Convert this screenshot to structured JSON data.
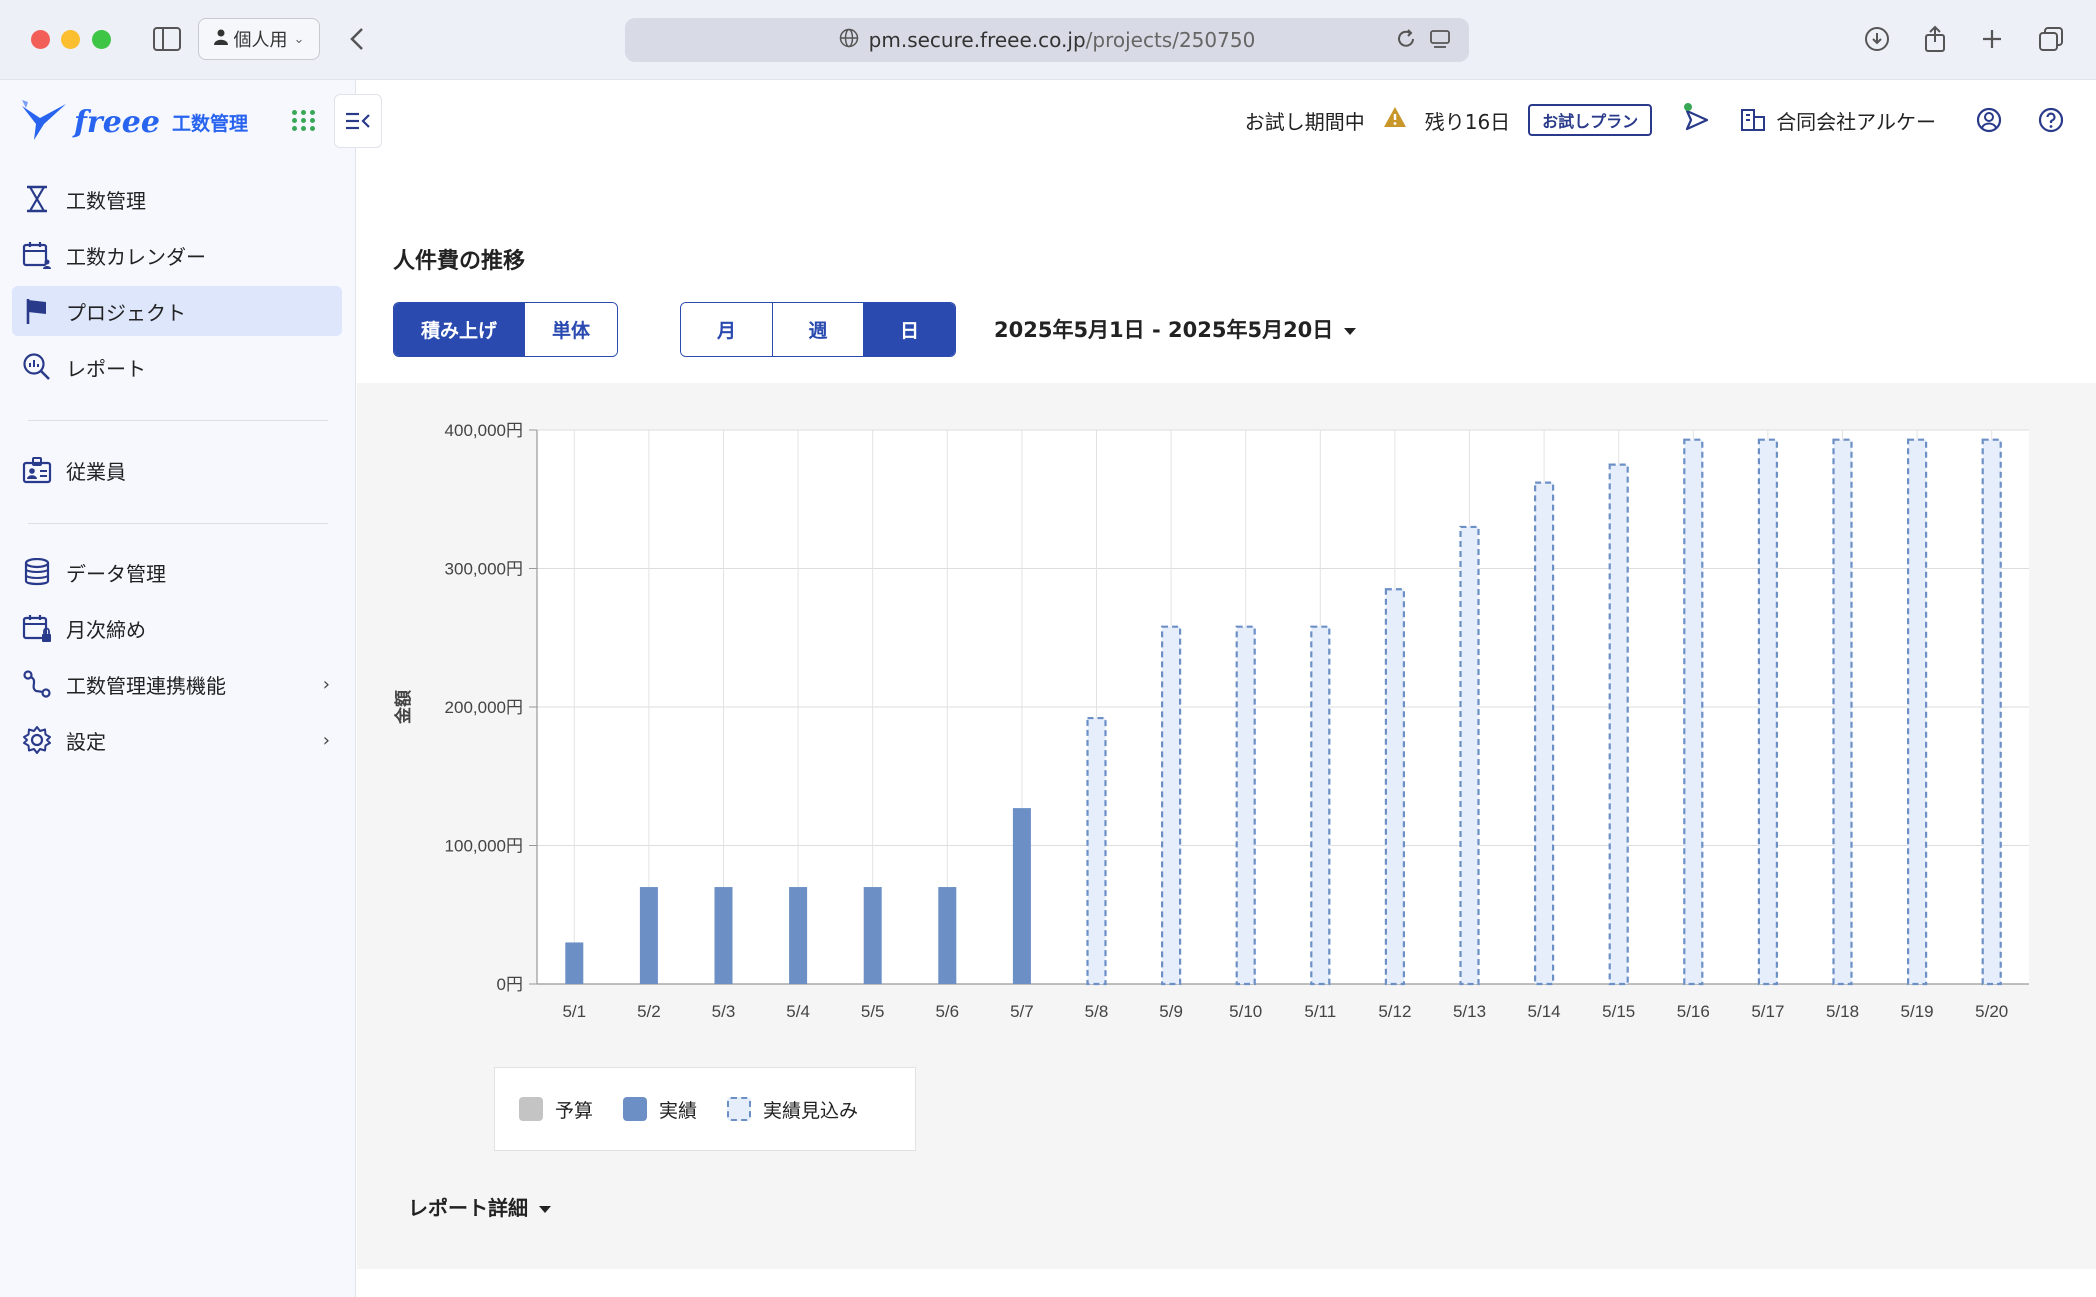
{
  "browser": {
    "profile_label": "個人用",
    "url_host": "pm.secure.freee.co.jp",
    "url_path": "/projects/250750"
  },
  "sidebar": {
    "logo_brand": "freee",
    "logo_product": "工数管理",
    "items": [
      {
        "label": "工数管理",
        "icon": "hourglass-icon"
      },
      {
        "label": "工数カレンダー",
        "icon": "calendar-user-icon"
      },
      {
        "label": "プロジェクト",
        "icon": "flag-icon"
      },
      {
        "label": "レポート",
        "icon": "report-search-icon"
      },
      {
        "label": "従業員",
        "icon": "employee-card-icon"
      },
      {
        "label": "データ管理",
        "icon": "database-icon"
      },
      {
        "label": "月次締め",
        "icon": "calendar-lock-icon"
      },
      {
        "label": "工数管理連携機能",
        "icon": "integration-icon"
      },
      {
        "label": "設定",
        "icon": "gear-icon"
      }
    ],
    "active_index": 2
  },
  "header": {
    "trial_status": "お試し期間中",
    "days_left": "残り16日",
    "plan_badge": "お試しプラン",
    "company": "合同会社アルケー"
  },
  "main": {
    "section_title": "人件費の推移",
    "mode_toggle": [
      "積み上げ",
      "単体"
    ],
    "mode_selected": 0,
    "period_toggle": [
      "月",
      "週",
      "日"
    ],
    "period_selected": 2,
    "date_range": "2025年5月1日 - 2025年5月20日",
    "report_detail": "レポート詳細"
  },
  "chart_data": {
    "type": "bar",
    "ylabel": "金額",
    "ylim": [
      0,
      400000
    ],
    "yticks": [
      "0円",
      "100,000円",
      "200,000円",
      "300,000円",
      "400,000円"
    ],
    "categories": [
      "5/1",
      "5/2",
      "5/3",
      "5/4",
      "5/5",
      "5/6",
      "5/7",
      "5/8",
      "5/9",
      "5/10",
      "5/11",
      "5/12",
      "5/13",
      "5/14",
      "5/15",
      "5/16",
      "5/17",
      "5/18",
      "5/19",
      "5/20"
    ],
    "series": [
      {
        "name": "実績",
        "values": [
          30000,
          70000,
          70000,
          70000,
          70000,
          70000,
          127000,
          null,
          null,
          null,
          null,
          null,
          null,
          null,
          null,
          null,
          null,
          null,
          null,
          null
        ]
      },
      {
        "name": "実績見込み",
        "values": [
          null,
          null,
          null,
          null,
          null,
          null,
          null,
          192000,
          258000,
          258000,
          258000,
          285000,
          330000,
          362000,
          375000,
          393000,
          393000,
          393000,
          393000,
          393000
        ]
      }
    ],
    "legend": [
      "予算",
      "実績",
      "実績見込み"
    ],
    "legend_position": "bottom-left",
    "colors": {
      "budget": "#c4c4c4",
      "actual": "#6c8fc6",
      "forecast_fill": "#e6eefb",
      "forecast_stroke": "#6c8fc6"
    }
  }
}
